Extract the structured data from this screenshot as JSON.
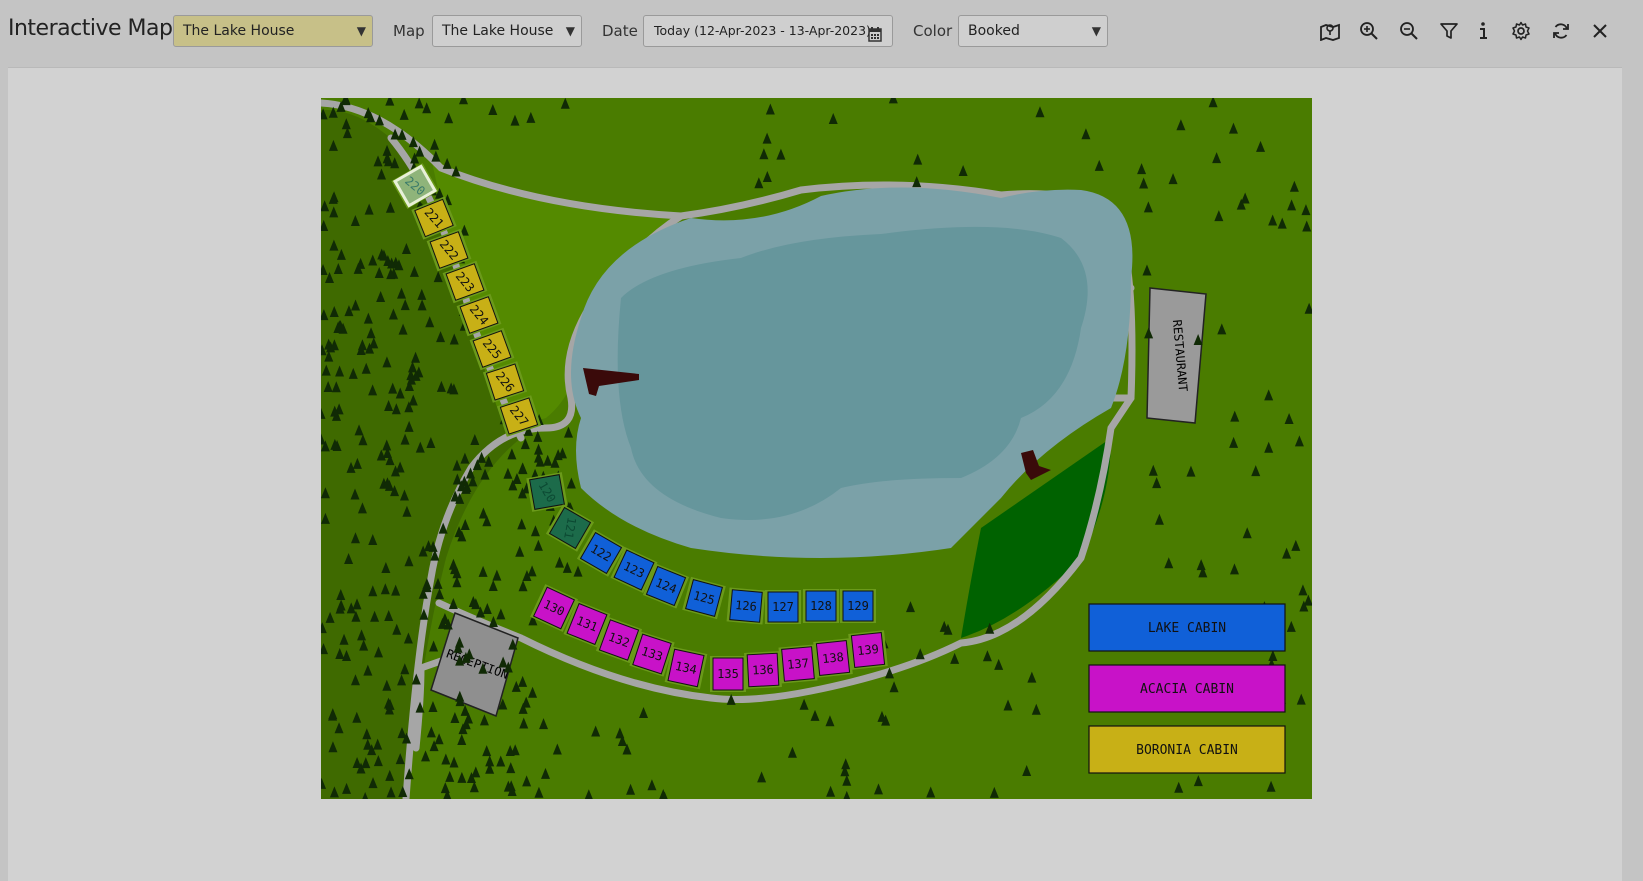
{
  "header": {
    "title": "Interactive Map",
    "property_select": "The Lake House",
    "map_label": "Map",
    "map_select": "The Lake House",
    "date_label": "Date",
    "date_value": "Today (12-Apr-2023 - 13-Apr-2023)",
    "color_label": "Color",
    "color_select": "Booked"
  },
  "toolbar_icons": [
    "map-icon",
    "zoom-in-icon",
    "zoom-out-icon",
    "filter-icon",
    "info-icon",
    "settings-gear-icon",
    "refresh-icon",
    "close-icon"
  ],
  "map": {
    "restaurant_label": "RESTAURANT",
    "reception_label": "RECEPTION",
    "units": {
      "boronia": [
        "220",
        "221",
        "222",
        "223",
        "224",
        "225",
        "226",
        "227"
      ],
      "lake": [
        "120",
        "121",
        "122",
        "123",
        "124",
        "125",
        "126",
        "127",
        "128",
        "129"
      ],
      "acacia": [
        "130",
        "131",
        "132",
        "133",
        "134",
        "135",
        "136",
        "137",
        "138",
        "139"
      ]
    },
    "legend": [
      {
        "label": "LAKE CABIN",
        "color": "#1060d8"
      },
      {
        "label": "ACACIA CABIN",
        "color": "#c812c8"
      },
      {
        "label": "BORONIA CABIN",
        "color": "#c8b016"
      }
    ]
  },
  "colors": {
    "property_select_bg": "#c7c088",
    "grass": "#4a7c00",
    "forest": "#3f6a00",
    "lake": "#7ba1a8",
    "lake_deep": "#66969c",
    "path": "#a6a6a6",
    "boronia": "#c8b016",
    "lake_cabin": "#1060d8",
    "acacia": "#c812c8",
    "booked_green": "#1c6b4a",
    "booked_selected": "#8fb47a"
  }
}
